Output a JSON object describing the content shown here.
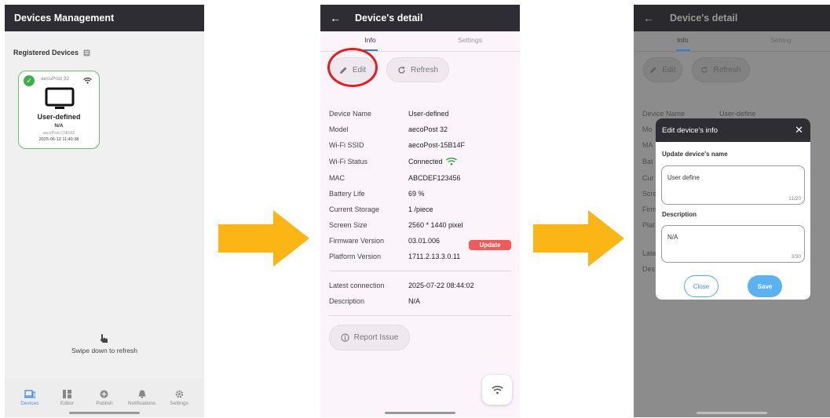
{
  "screen1": {
    "title": "Devices Management",
    "section_title": "Registered Devices",
    "device": {
      "model": "aecoPost 32",
      "name": "User-defined",
      "na": "N/A",
      "sub": "aecoPost-C0E663",
      "time": "2025-06-12 11:40:38"
    },
    "swipe_text": "Swipe down to refresh",
    "nav": [
      "Devices",
      "Editor",
      "Publish",
      "Notifications",
      "Settings"
    ]
  },
  "screen2": {
    "title": "Device's detail",
    "tabs": [
      "Info",
      "Settings"
    ],
    "edit_label": "Edit",
    "refresh_label": "Refresh",
    "rows": [
      {
        "k": "Device Name",
        "v": "User-defined"
      },
      {
        "k": "Model",
        "v": "aecoPost 32"
      },
      {
        "k": "Wi-Fi SSID",
        "v": "aecoPost-15B14F"
      },
      {
        "k": "Wi-Fi Status",
        "v": "Connected"
      },
      {
        "k": "MAC",
        "v": "ABCDEF123456"
      },
      {
        "k": "Battery Life",
        "v": "69 %"
      },
      {
        "k": "Current Storage",
        "v": "1  /piece"
      },
      {
        "k": "Screen Size",
        "v": "2560 * 1440 pixel"
      },
      {
        "k": "Firmware Version",
        "v": "03.01.006"
      },
      {
        "k": "Platform Version",
        "v": "1711.2.13.3.0.11"
      }
    ],
    "update_label": "Update",
    "rows2": [
      {
        "k": "Latest connection",
        "v": "2025-07-22 08:44:02"
      },
      {
        "k": "Description",
        "v": "N/A"
      }
    ],
    "report_label": "Report Issue",
    "status_color": "#3fae4d",
    "update_color": "#ef5b5b"
  },
  "screen3": {
    "title": "Device's detail",
    "tabs": [
      "Info",
      "Setting"
    ],
    "edit_label": "Edit",
    "refresh_label": "Refresh",
    "dim_rows": [
      "Device Name",
      "Mo",
      "MA",
      "Bat",
      "Cur",
      "Scre",
      "Firm",
      "Plat",
      "Late",
      "Des"
    ],
    "dim_value": "User-define",
    "dialog": {
      "title": "Edit device's info",
      "name_label": "Update device's name",
      "name_value": "User define",
      "name_count": "11/20",
      "desc_label": "Description",
      "desc_value": "N/A",
      "desc_count": "3/30",
      "close_label": "Close",
      "save_label": "Save"
    }
  },
  "arrow_color": "#fbb515"
}
